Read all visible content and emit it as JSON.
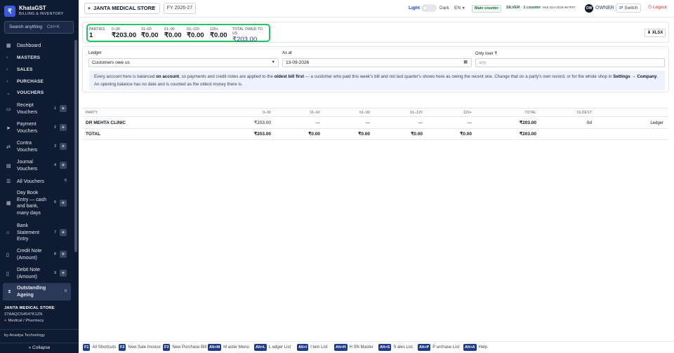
{
  "brand": {
    "logo": "₹",
    "name": "KhataGST",
    "subtitle": "BILLING & INVENTORY"
  },
  "search": {
    "placeholder": "Search anything",
    "shortcut": "Ctrl+K"
  },
  "nav": {
    "dashboard": "Dashboard",
    "masters": "MASTERS",
    "sales": "SALES",
    "purchase": "PURCHASE",
    "vouchers": "VOUCHERS",
    "items": [
      {
        "label": "Receipt Vouchers",
        "num": "1"
      },
      {
        "label": "Payment Vouchers",
        "num": "2"
      },
      {
        "label": "Contra Vouchers",
        "num": "3"
      },
      {
        "label": "Journal Vouchers",
        "num": "4"
      },
      {
        "label": "All Vouchers",
        "num": "5"
      },
      {
        "label": "Day Book Entry — cash and bank, many days",
        "num": "6"
      },
      {
        "label": "Bank Statement Entry",
        "num": "7"
      },
      {
        "label": "Credit Note (Amount)",
        "num": "8"
      },
      {
        "label": "Debit Note (Amount)",
        "num": "9"
      },
      {
        "label": "Outstanding Ageing",
        "num": "0"
      }
    ]
  },
  "store": {
    "name": "JANTA MEDICAL STORE",
    "gstin": "27AAQCS4547K1ZN",
    "type": "Medical / Pharmacy"
  },
  "byline": "by Anadya Technology",
  "collapse": "« Collapse",
  "topbar": {
    "store": "JANTA MEDICAL STORE",
    "fy": "FY 2026-27",
    "light": "Light",
    "dark": "Dark",
    "lang": "EN",
    "main_counter": "Main counter",
    "license": "SILVER · 1 counter",
    "license_key": "ANS-SLV-2026-4E7F97",
    "owner_initials": "OW",
    "owner": "OWNER",
    "switch": "Switch",
    "logout": "Logout"
  },
  "summary": {
    "cols": [
      {
        "label": "PARTIES",
        "value": "1"
      },
      {
        "label": "0–30",
        "value": "₹203.00"
      },
      {
        "label": "31–60",
        "value": "₹0.00"
      },
      {
        "label": "61–90",
        "value": "₹0.00"
      },
      {
        "label": "91–120",
        "value": "₹0.00"
      },
      {
        "label": "120+",
        "value": "₹0.00"
      },
      {
        "label": "TOTAL OWED TO US",
        "value": "₹203.00"
      }
    ],
    "export": "XLSX"
  },
  "filters": {
    "ledger_label": "Ledger",
    "ledger_value": "Customers owe us",
    "asat_label": "As at",
    "asat_value": "13-09-2026",
    "over_label": "Only over ₹",
    "over_placeholder": "any"
  },
  "info": {
    "t1": "Every account here is balanced ",
    "b1": "on account",
    "t2": ", so payments and credit notes are applied to the ",
    "b2": "oldest bill first",
    "t3": " — a customer who paid this week's bill and not last quarter's shows here as owing the recent one. Change that on a party's own record, or for the whole shop in ",
    "b3": "Settings → Company",
    "t4": ". An opening balance has no date and is counted as the oldest money there is."
  },
  "table": {
    "headers": [
      "PARTY",
      "0–30",
      "31–60",
      "61–90",
      "91–120",
      "120+",
      "TOTAL",
      "OLDEST"
    ],
    "rows": [
      {
        "party": "DR MEHTA CLINIC",
        "b0": "₹203.00",
        "b1": "—",
        "b2": "—",
        "b3": "—",
        "b4": "—",
        "total": "₹203.00",
        "oldest": "0d",
        "action": "Ledger"
      }
    ],
    "total": {
      "label": "TOTAL",
      "b0": "₹203.00",
      "b1": "₹0.00",
      "b2": "₹0.00",
      "b3": "₹0.00",
      "b4": "₹0.00",
      "total": "₹203.00"
    }
  },
  "shortcuts": [
    {
      "key": "F1",
      "label": "All Shortcuts"
    },
    {
      "key": "F2",
      "label": "New Sale Invoice"
    },
    {
      "key": "F3",
      "label": "New Purchase Bill"
    },
    {
      "key": "Alt+M",
      "label": "M aster Menu"
    },
    {
      "key": "Alt+L",
      "label": "L edger List"
    },
    {
      "key": "Alt+I",
      "label": "I tem List"
    },
    {
      "key": "Alt+H",
      "label": "H SN Master"
    },
    {
      "key": "Alt+S",
      "label": "S ales List"
    },
    {
      "key": "Alt+P",
      "label": "P urchase List"
    },
    {
      "key": "Alt+A",
      "label": "Help"
    }
  ]
}
